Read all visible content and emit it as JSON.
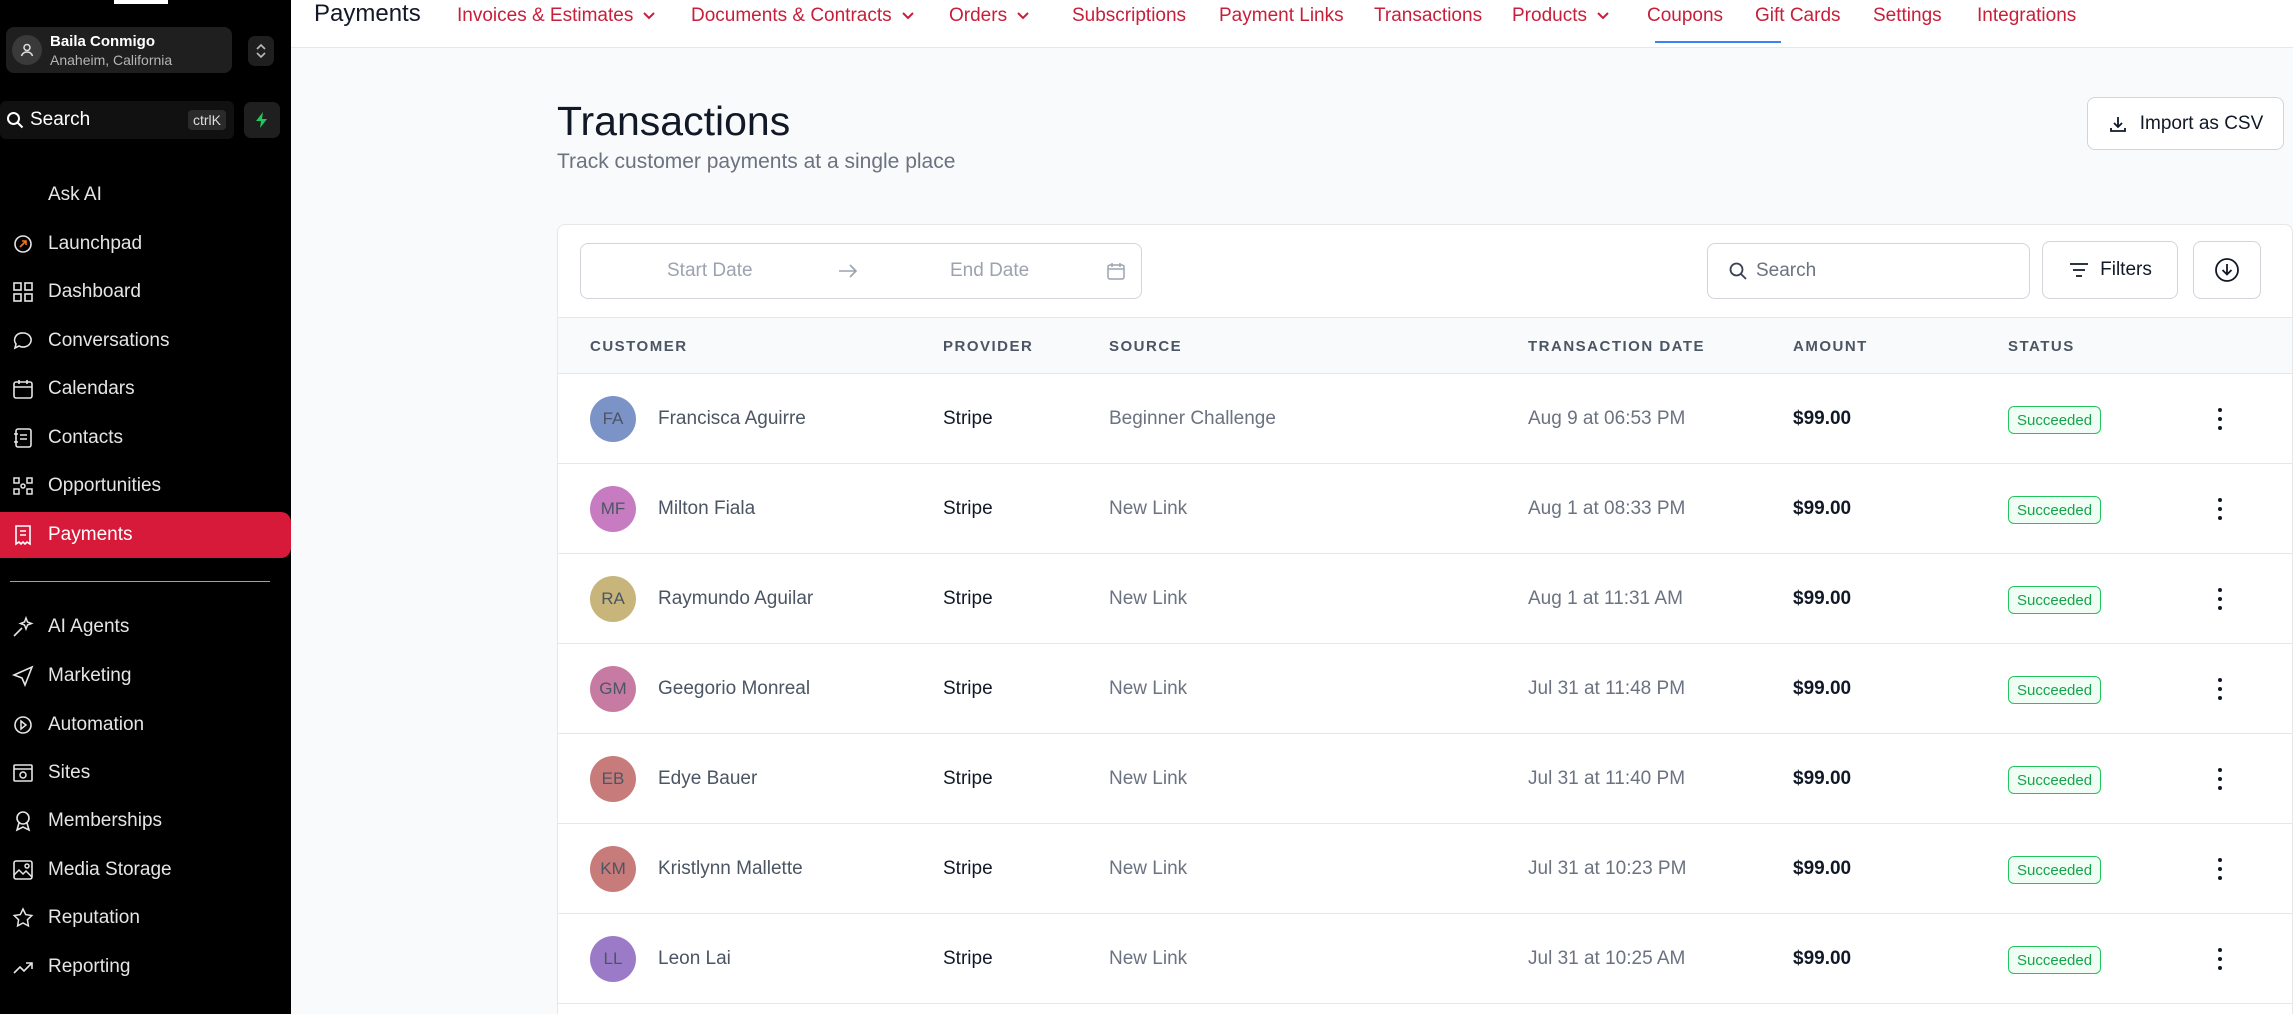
{
  "sidebar": {
    "location": {
      "name": "Baila Conmigo",
      "sub": "Anaheim, California"
    },
    "search": {
      "label": "Search",
      "shortcut": "ctrlK"
    },
    "items_top": [
      {
        "label": "Ask AI",
        "icon": "sparkle-icon"
      },
      {
        "label": "Launchpad",
        "icon": "rocket-icon"
      },
      {
        "label": "Dashboard",
        "icon": "grid-icon"
      },
      {
        "label": "Conversations",
        "icon": "chat-bubble-icon"
      },
      {
        "label": "Calendars",
        "icon": "calendar-icon"
      },
      {
        "label": "Contacts",
        "icon": "contacts-icon"
      },
      {
        "label": "Opportunities",
        "icon": "network-icon"
      },
      {
        "label": "Payments",
        "icon": "receipt-icon",
        "active": true
      }
    ],
    "items_bottom": [
      {
        "label": "AI Agents",
        "icon": "ai-agents-icon"
      },
      {
        "label": "Marketing",
        "icon": "send-icon"
      },
      {
        "label": "Automation",
        "icon": "automation-icon"
      },
      {
        "label": "Sites",
        "icon": "sites-icon"
      },
      {
        "label": "Memberships",
        "icon": "badge-icon"
      },
      {
        "label": "Media Storage",
        "icon": "image-icon"
      },
      {
        "label": "Reputation",
        "icon": "star-icon"
      },
      {
        "label": "Reporting",
        "icon": "trend-icon"
      }
    ]
  },
  "topnav": {
    "title": "Payments",
    "tabs": [
      {
        "label": "Invoices & Estimates",
        "dropdown": true
      },
      {
        "label": "Documents & Contracts",
        "dropdown": true
      },
      {
        "label": "Orders",
        "dropdown": true
      },
      {
        "label": "Subscriptions",
        "dropdown": false
      },
      {
        "label": "Payment Links",
        "dropdown": false
      },
      {
        "label": "Transactions",
        "dropdown": false,
        "active": true
      },
      {
        "label": "Products",
        "dropdown": true
      },
      {
        "label": "Coupons",
        "dropdown": false
      },
      {
        "label": "Gift Cards",
        "dropdown": false
      },
      {
        "label": "Settings",
        "dropdown": false
      },
      {
        "label": "Integrations",
        "dropdown": false
      }
    ]
  },
  "page": {
    "title": "Transactions",
    "subtitle": "Track customer payments at a single place",
    "import_label": "Import as CSV"
  },
  "toolbar": {
    "start_date_placeholder": "Start Date",
    "end_date_placeholder": "End Date",
    "search_placeholder": "Search",
    "filters_label": "Filters"
  },
  "table": {
    "headers": [
      "CUSTOMER",
      "PROVIDER",
      "SOURCE",
      "TRANSACTION DATE",
      "AMOUNT",
      "STATUS"
    ],
    "rows": [
      {
        "initials": "FA",
        "color": "#7b93c7",
        "customer": "Francisca Aguirre",
        "provider": "Stripe",
        "source": "Beginner Challenge",
        "date": "Aug 9 at 06:53 PM",
        "amount": "$99.00",
        "status": "Succeeded"
      },
      {
        "initials": "MF",
        "color": "#c77bc1",
        "customer": "Milton Fiala",
        "provider": "Stripe",
        "source": "New Link",
        "date": "Aug 1 at 08:33 PM",
        "amount": "$99.00",
        "status": "Succeeded"
      },
      {
        "initials": "RA",
        "color": "#c7b57b",
        "customer": "Raymundo Aguilar",
        "provider": "Stripe",
        "source": "New Link",
        "date": "Aug 1 at 11:31 AM",
        "amount": "$99.00",
        "status": "Succeeded"
      },
      {
        "initials": "GM",
        "color": "#c77ba2",
        "customer": "Geegorio Monreal",
        "provider": "Stripe",
        "source": "New Link",
        "date": "Jul 31 at 11:48 PM",
        "amount": "$99.00",
        "status": "Succeeded"
      },
      {
        "initials": "EB",
        "color": "#c77b7b",
        "customer": "Edye Bauer",
        "provider": "Stripe",
        "source": "New Link",
        "date": "Jul 31 at 11:40 PM",
        "amount": "$99.00",
        "status": "Succeeded"
      },
      {
        "initials": "KM",
        "color": "#c77b7b",
        "customer": "Kristlynn Mallette",
        "provider": "Stripe",
        "source": "New Link",
        "date": "Jul 31 at 10:23 PM",
        "amount": "$99.00",
        "status": "Succeeded"
      },
      {
        "initials": "LL",
        "color": "#9b7bc7",
        "customer": "Leon Lai",
        "provider": "Stripe",
        "source": "New Link",
        "date": "Jul 31 at 10:25 AM",
        "amount": "$99.00",
        "status": "Succeeded"
      }
    ]
  }
}
